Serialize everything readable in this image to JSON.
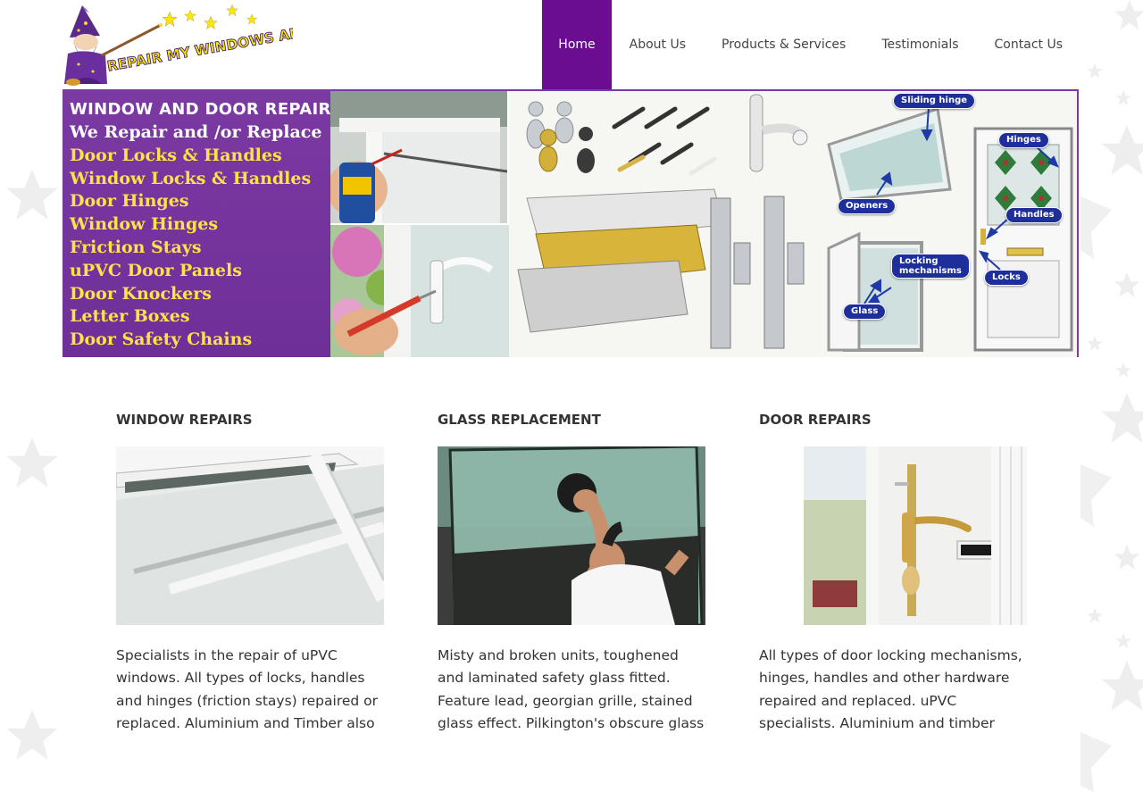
{
  "brand": {
    "logo_text": "REPAIR MY WINDOWS AND DOORS"
  },
  "nav": {
    "items": [
      {
        "label": "Home",
        "active": true
      },
      {
        "label": "About Us",
        "active": false
      },
      {
        "label": "Products & Services",
        "active": false
      },
      {
        "label": "Testimonials",
        "active": false
      },
      {
        "label": "Contact Us",
        "active": false
      }
    ],
    "active_color": "#6a0d91"
  },
  "banner": {
    "heading": "WINDOW AND DOOR REPAIRS",
    "subheading": "We Repair and /or Replace",
    "list": [
      "Door Locks & Handles",
      "Window Locks & Handles",
      "Door Hinges",
      "Window Hinges",
      "Friction Stays",
      "uPVC Door Panels",
      "Door Knockers",
      "Letter Boxes",
      "Door Safety Chains"
    ],
    "callouts": {
      "sliding_hinge": "Sliding hinge",
      "hinges": "Hinges",
      "openers": "Openers",
      "handles": "Handles",
      "locking_mechanisms_line1": "Locking",
      "locking_mechanisms_line2": "mechanisms",
      "locks": "Locks",
      "glass": "Glass"
    },
    "accent_color": "#7b3aa5"
  },
  "services": [
    {
      "title": "WINDOW REPAIRS",
      "text": "Specialists in the repair of uPVC windows. All types of locks, handles and hinges (friction stays) repaired or replaced. Aluminium and Timber also"
    },
    {
      "title": "GLASS REPLACEMENT",
      "text": "Misty and broken units, toughened and laminated safety glass fitted. Feature lead, georgian grille, stained glass effect. Pilkington's obscure glass"
    },
    {
      "title": "DOOR REPAIRS",
      "text": "All types of door locking mechanisms, hinges, handles and other hardware repaired and replaced. uPVC specialists. Aluminium and timber"
    }
  ]
}
